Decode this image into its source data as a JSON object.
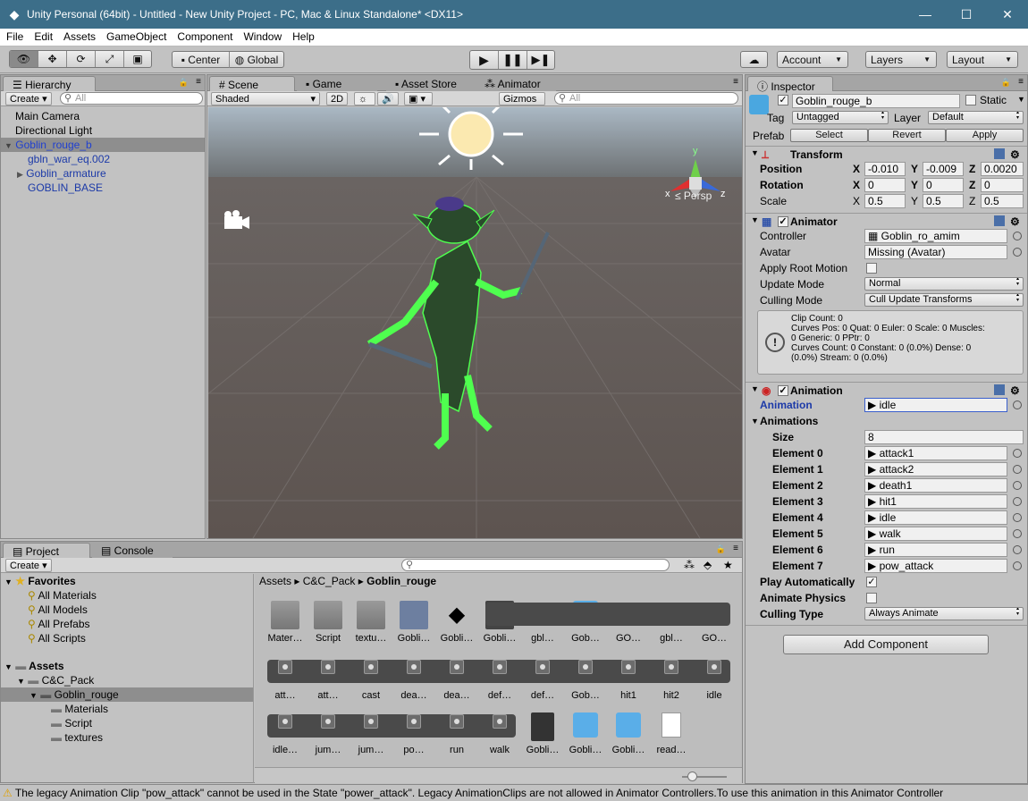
{
  "window": {
    "title": "Unity Personal (64bit) - Untitled - New Unity Project - PC, Mac & Linux Standalone* <DX11>",
    "minimize": "—",
    "maximize": "☐",
    "close": "✕"
  },
  "menu": [
    "File",
    "Edit",
    "Assets",
    "GameObject",
    "Component",
    "Window",
    "Help"
  ],
  "toolbar": {
    "center": "Center",
    "global": "Global",
    "account": "Account",
    "layers": "Layers",
    "layout": "Layout"
  },
  "hierarchy": {
    "tab": "Hierarchy",
    "create": "Create",
    "search_placeholder": "All",
    "items": [
      "Main Camera",
      "Directional Light",
      "Goblin_rouge_b",
      "gbln_war_eq.002",
      "Goblin_armature",
      "GOBLIN_BASE"
    ]
  },
  "scene": {
    "tabs": [
      "Scene",
      "Game",
      "Asset Store",
      "Animator"
    ],
    "shaded": "Shaded",
    "mode2d": "2D",
    "gizmos": "Gizmos",
    "search_placeholder": "All",
    "persp": "Persp",
    "axis_x": "x",
    "axis_y": "y",
    "axis_z": "z"
  },
  "inspector": {
    "tab": "Inspector",
    "name": "Goblin_rouge_b",
    "static": "Static",
    "tag_label": "Tag",
    "tag": "Untagged",
    "layer_label": "Layer",
    "layer": "Default",
    "prefab_label": "Prefab",
    "prefab_select": "Select",
    "prefab_revert": "Revert",
    "prefab_apply": "Apply",
    "transform": {
      "title": "Transform",
      "position_label": "Position",
      "rotation_label": "Rotation",
      "scale_label": "Scale",
      "position": [
        "-0.010",
        "-0.009",
        "0.0020"
      ],
      "rotation": [
        "0",
        "0",
        "0"
      ],
      "scale": [
        "0.5",
        "0.5",
        "0.5"
      ]
    },
    "animator": {
      "title": "Animator",
      "controller_label": "Controller",
      "controller": "Goblin_ro_amim",
      "avatar_label": "Avatar",
      "avatar": "Missing (Avatar)",
      "root_motion_label": "Apply Root Motion",
      "update_mode_label": "Update Mode",
      "update_mode": "Normal",
      "culling_mode_label": "Culling Mode",
      "culling_mode": "Cull Update Transforms",
      "info": [
        "Clip Count: 0",
        "Curves Pos: 0 Quat: 0 Euler: 0 Scale: 0 Muscles:",
        "0 Generic: 0 PPtr: 0",
        "Curves Count: 0 Constant: 0 (0.0%) Dense: 0",
        "(0.0%) Stream: 0 (0.0%)"
      ]
    },
    "animation": {
      "title": "Animation",
      "animation_label": "Animation",
      "animation": "idle",
      "animations_label": "Animations",
      "size_label": "Size",
      "size": "8",
      "elements": [
        {
          "label": "Element 0",
          "value": "attack1"
        },
        {
          "label": "Element 1",
          "value": "attack2"
        },
        {
          "label": "Element 2",
          "value": "death1"
        },
        {
          "label": "Element 3",
          "value": "hit1"
        },
        {
          "label": "Element 4",
          "value": "idle"
        },
        {
          "label": "Element 5",
          "value": "walk"
        },
        {
          "label": "Element 6",
          "value": "run"
        },
        {
          "label": "Element 7",
          "value": "pow_attack"
        }
      ],
      "play_auto_label": "Play Automatically",
      "animate_physics_label": "Animate Physics",
      "culling_type_label": "Culling Type",
      "culling_type": "Always Animate"
    },
    "add_component": "Add Component"
  },
  "project": {
    "tabs": [
      "Project",
      "Console"
    ],
    "create": "Create",
    "favorites_label": "Favorites",
    "favorites": [
      "All Materials",
      "All Models",
      "All Prefabs",
      "All Scripts"
    ],
    "assets_label": "Assets",
    "tree": [
      "C&C_Pack",
      "Goblin_rouge",
      "Materials",
      "Script",
      "textures"
    ],
    "breadcrumb": [
      "Assets",
      "C&C_Pack",
      "Goblin_rouge"
    ],
    "row1": [
      "Mater…",
      "Script",
      "textu…",
      "Gobli…",
      "Gobli…",
      "Gobli…",
      "gbl…",
      "Gob…",
      "GO…",
      "gbl…",
      "GO…"
    ],
    "row2": [
      "att…",
      "att…",
      "cast",
      "dea…",
      "dea…",
      "def…",
      "def…",
      "Gob…",
      "hit1",
      "hit2",
      "idle"
    ],
    "row3": [
      "idle…",
      "jum…",
      "jum…",
      "po…",
      "run",
      "walk",
      "Gobli…",
      "Gobli…",
      "Gobli…",
      "read…"
    ]
  },
  "status": "The legacy Animation Clip \"pow_attack\" cannot be used in the State \"power_attack\". Legacy AnimationClips are not allowed in Animator Controllers.To use this animation in this Animator Controller"
}
